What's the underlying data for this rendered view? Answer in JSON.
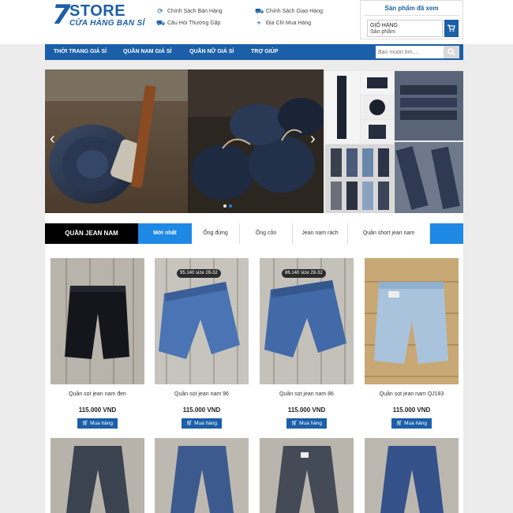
{
  "brand": {
    "logo_number": "7",
    "logo_name": "STORE",
    "logo_tagline": "CỬA HÀNG BẠN SỈ"
  },
  "header": {
    "policies": [
      {
        "icon": "refresh-icon",
        "label": "Chính Sách Bán Hàng"
      },
      {
        "icon": "truck-icon",
        "label": "Chính Sách Giao Hàng"
      },
      {
        "icon": "truck-icon",
        "label": "Câu Hỏi Thường Gặp"
      },
      {
        "icon": "location-icon",
        "label": "Địa Chỉ Mua Hàng"
      }
    ],
    "viewed_title": "Sản phẩm đã xem",
    "cart_label": "GIỎ HÀNG",
    "cart_sub": "Sản phẩm"
  },
  "nav": {
    "items": [
      "THỜI TRANG GIÁ SỈ",
      "QUẦN NAM GIÁ SỈ",
      "QUẦN NỮ GIÁ SỈ",
      "TRỢ GIÚP"
    ],
    "search_placeholder": "Bạn muốn tìm...."
  },
  "tabs": {
    "category": "QUẦN JEAN NAM",
    "items": [
      "Mới nhất",
      "Ống đứng",
      "Ống côn",
      "Jean nam rách",
      "Quần short jean nam"
    ]
  },
  "products": [
    {
      "name": "Quần sọt jean nam đen",
      "price": "115.000 VND",
      "buy": "Mua hàng",
      "tag": ""
    },
    {
      "name": "Quần sọt jean nam 96",
      "price": "115.000 VND",
      "buy": "Mua hàng",
      "tag": "95.140 size 28-32"
    },
    {
      "name": "Quần sọt jean nam 86",
      "price": "115.000 VND",
      "buy": "Mua hàng",
      "tag": "86.140 size 28-32"
    },
    {
      "name": "Quần sọt jean nam QJ183",
      "price": "115.000 VND",
      "buy": "Mua hàng",
      "tag": ""
    }
  ],
  "colors": {
    "brand": "#1b5fa8",
    "tab_active": "#1e88e5",
    "category_bg": "#000000"
  }
}
